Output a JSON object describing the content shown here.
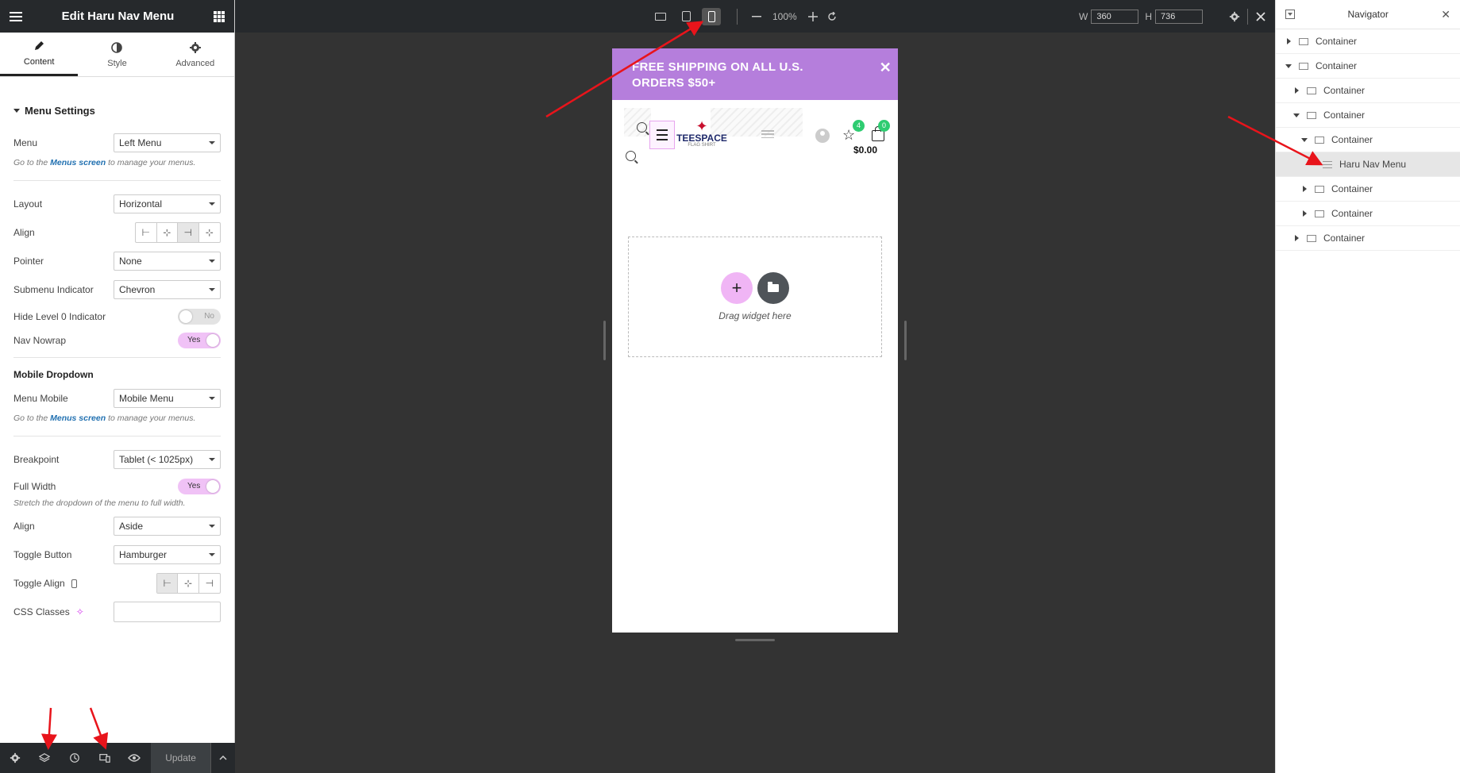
{
  "left_panel": {
    "title": "Edit Haru Nav Menu",
    "tabs": [
      {
        "label": "Content",
        "icon": "pencil-icon"
      },
      {
        "label": "Style",
        "icon": "half-circle-icon"
      },
      {
        "label": "Advanced",
        "icon": "gear-icon"
      }
    ],
    "menu_settings": {
      "title": "Menu Settings",
      "menu_label": "Menu",
      "menu_value": "Left Menu",
      "note_prefix": "Go to the",
      "note_link": "Menus screen",
      "note_suffix": "to manage your menus.",
      "layout_label": "Layout",
      "layout_value": "Horizontal",
      "align_label": "Align",
      "pointer_label": "Pointer",
      "pointer_value": "None",
      "submenu_label": "Submenu Indicator",
      "submenu_value": "Chevron",
      "hide_level_label": "Hide Level 0 Indicator",
      "hide_level_value": "No",
      "nav_nowrap_label": "Nav Nowrap",
      "nav_nowrap_value": "Yes"
    },
    "mobile_dropdown": {
      "title": "Mobile Dropdown",
      "menu_mobile_label": "Menu Mobile",
      "menu_mobile_value": "Mobile Menu",
      "note_prefix": "Go to the",
      "note_link": "Menus screen",
      "note_suffix": "to manage your menus.",
      "breakpoint_label": "Breakpoint",
      "breakpoint_value": "Tablet (< 1025px)",
      "full_width_label": "Full Width",
      "full_width_value": "Yes",
      "full_width_note": "Stretch the dropdown of the menu to full width.",
      "align_label": "Align",
      "align_value": "Aside",
      "toggle_button_label": "Toggle Button",
      "toggle_button_value": "Hamburger",
      "toggle_align_label": "Toggle Align",
      "css_classes_label": "CSS Classes",
      "css_classes_value": ""
    },
    "footer": {
      "update_label": "Update"
    }
  },
  "top_bar": {
    "zoom": "100%",
    "width_label": "W",
    "width_value": "360",
    "height_label": "H",
    "height_value": "736"
  },
  "preview": {
    "promo_text": "FREE SHIPPING ON ALL U.S. ORDERS $50+",
    "logo_name": "TEESPACE",
    "logo_sub": "FLAG SHIRT",
    "wishlist_count": "4",
    "cart_count": "0",
    "cart_total": "$0.00",
    "drop_text": "Drag widget here"
  },
  "navigator": {
    "title": "Navigator",
    "items": [
      {
        "label": "Container",
        "depth": 0,
        "expanded": false
      },
      {
        "label": "Container",
        "depth": 0,
        "expanded": true
      },
      {
        "label": "Container",
        "depth": 1,
        "expanded": false
      },
      {
        "label": "Container",
        "depth": 1,
        "expanded": true
      },
      {
        "label": "Container",
        "depth": 2,
        "expanded": true
      },
      {
        "label": "Haru Nav Menu",
        "depth": 3,
        "selected": true
      },
      {
        "label": "Container",
        "depth": 2,
        "expanded": false
      },
      {
        "label": "Container",
        "depth": 2,
        "expanded": false
      },
      {
        "label": "Container",
        "depth": 1,
        "expanded": false
      }
    ]
  },
  "colors": {
    "accent": "#f0b5f5",
    "promo": "#b57edc",
    "badge": "#2ecc71",
    "annotation": "#e8141b"
  }
}
